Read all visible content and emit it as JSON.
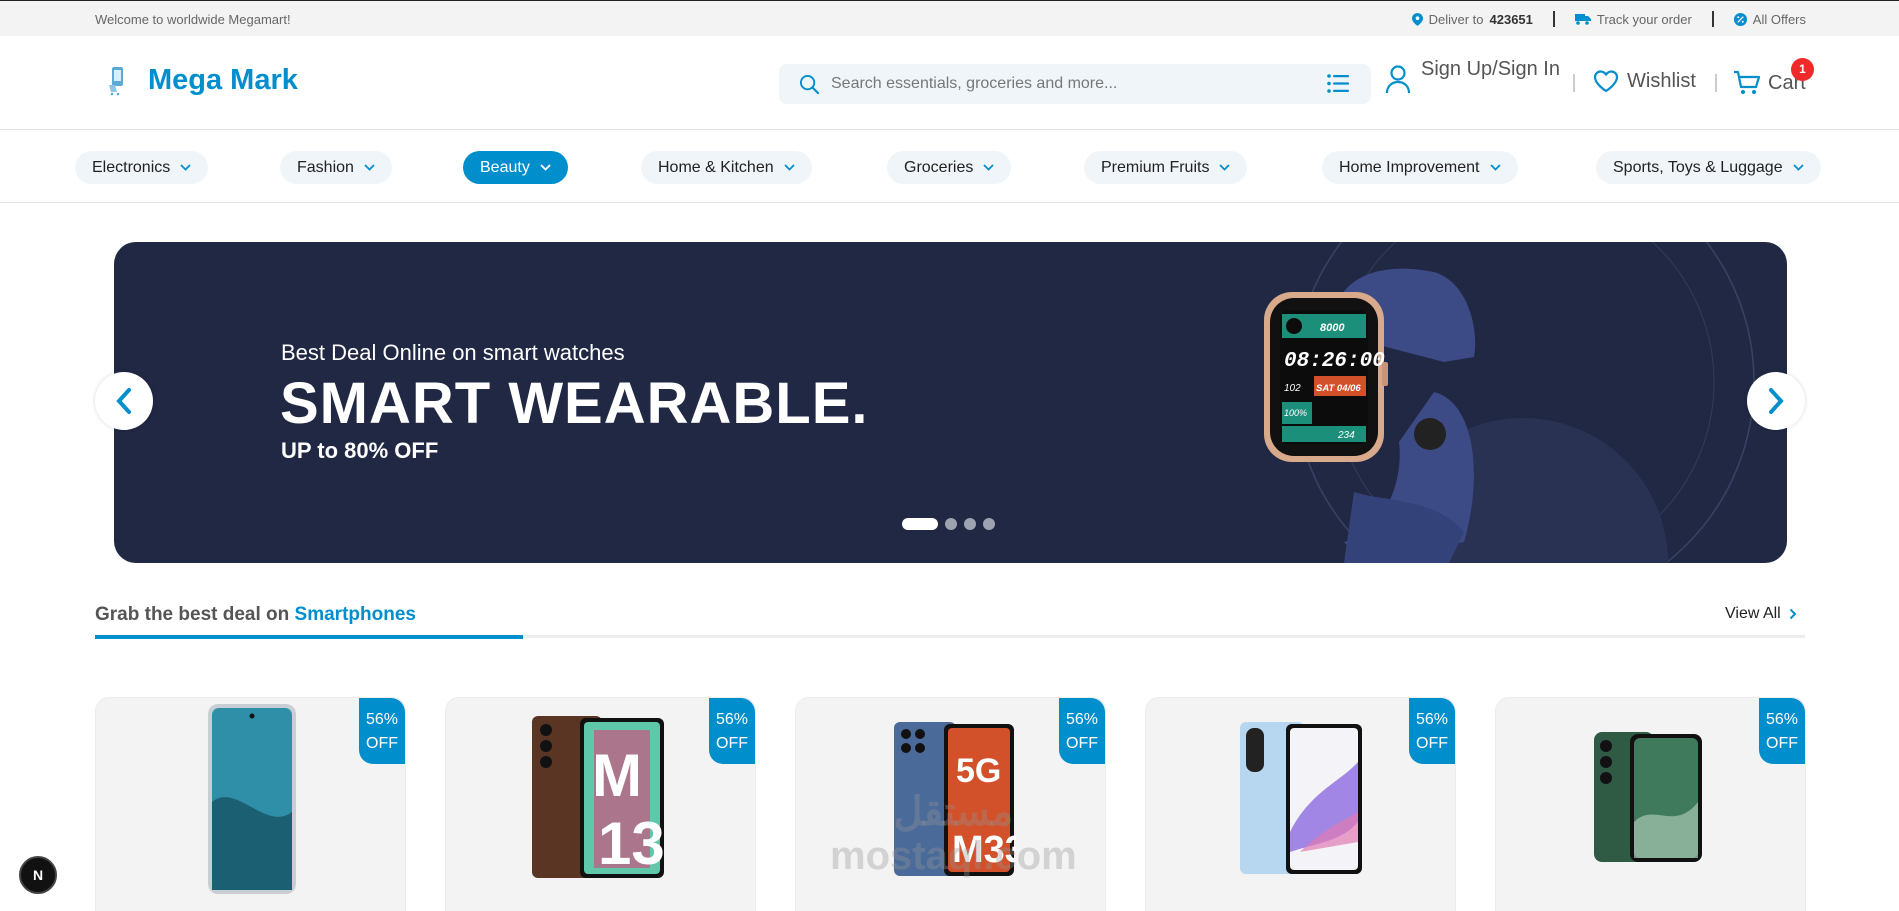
{
  "topbar": {
    "welcome": "Welcome to worldwide Megamart!",
    "deliver_prefix": "Deliver to",
    "deliver_code": "423651",
    "track": "Track your order",
    "offers": "All Offers"
  },
  "header": {
    "logo": "Mega Mark",
    "search_placeholder": "Search essentials, groceries and more...",
    "account": "Sign Up/Sign In",
    "wishlist": "Wishlist",
    "cart": "Cart",
    "cart_count": "1"
  },
  "categories": [
    {
      "label": "Electronics",
      "active": false
    },
    {
      "label": "Fashion",
      "active": false
    },
    {
      "label": "Beauty",
      "active": true
    },
    {
      "label": "Home & Kitchen",
      "active": false
    },
    {
      "label": "Groceries",
      "active": false
    },
    {
      "label": "Premium Fruits",
      "active": false
    },
    {
      "label": "Home Improvement",
      "active": false
    },
    {
      "label": "Sports, Toys & Luggage",
      "active": false
    }
  ],
  "banner": {
    "subtitle": "Best Deal Online on smart watches",
    "title": "SMART WEARABLE.",
    "offer": "UP to 80% OFF",
    "watch": {
      "steps": "8000",
      "time": "08:26:00",
      "heart": "102",
      "date": "SAT 04/06",
      "battery": "100%",
      "calories": "234"
    },
    "slides": 4,
    "active_slide": 1
  },
  "section": {
    "title_prefix": "Grab the best deal on",
    "title_highlight": "Smartphones",
    "view_all": "View All"
  },
  "products": [
    {
      "discount": "56%",
      "off": "OFF",
      "phone_color": "#2f8fa8"
    },
    {
      "discount": "56%",
      "off": "OFF",
      "phone_color": "#5a3524"
    },
    {
      "discount": "56%",
      "off": "OFF",
      "phone_color": "#4a6b9a"
    },
    {
      "discount": "56%",
      "off": "OFF",
      "phone_color": "#b7d6f0"
    },
    {
      "discount": "56%",
      "off": "OFF",
      "phone_color": "#2f5a44"
    }
  ],
  "watermark": {
    "line1": "مستقل",
    "line2": "mostaql.com"
  },
  "dev_badge": "N",
  "colors": {
    "accent": "#008ecc",
    "banner_bg": "#212844",
    "badge_red": "#ee2a2a"
  }
}
